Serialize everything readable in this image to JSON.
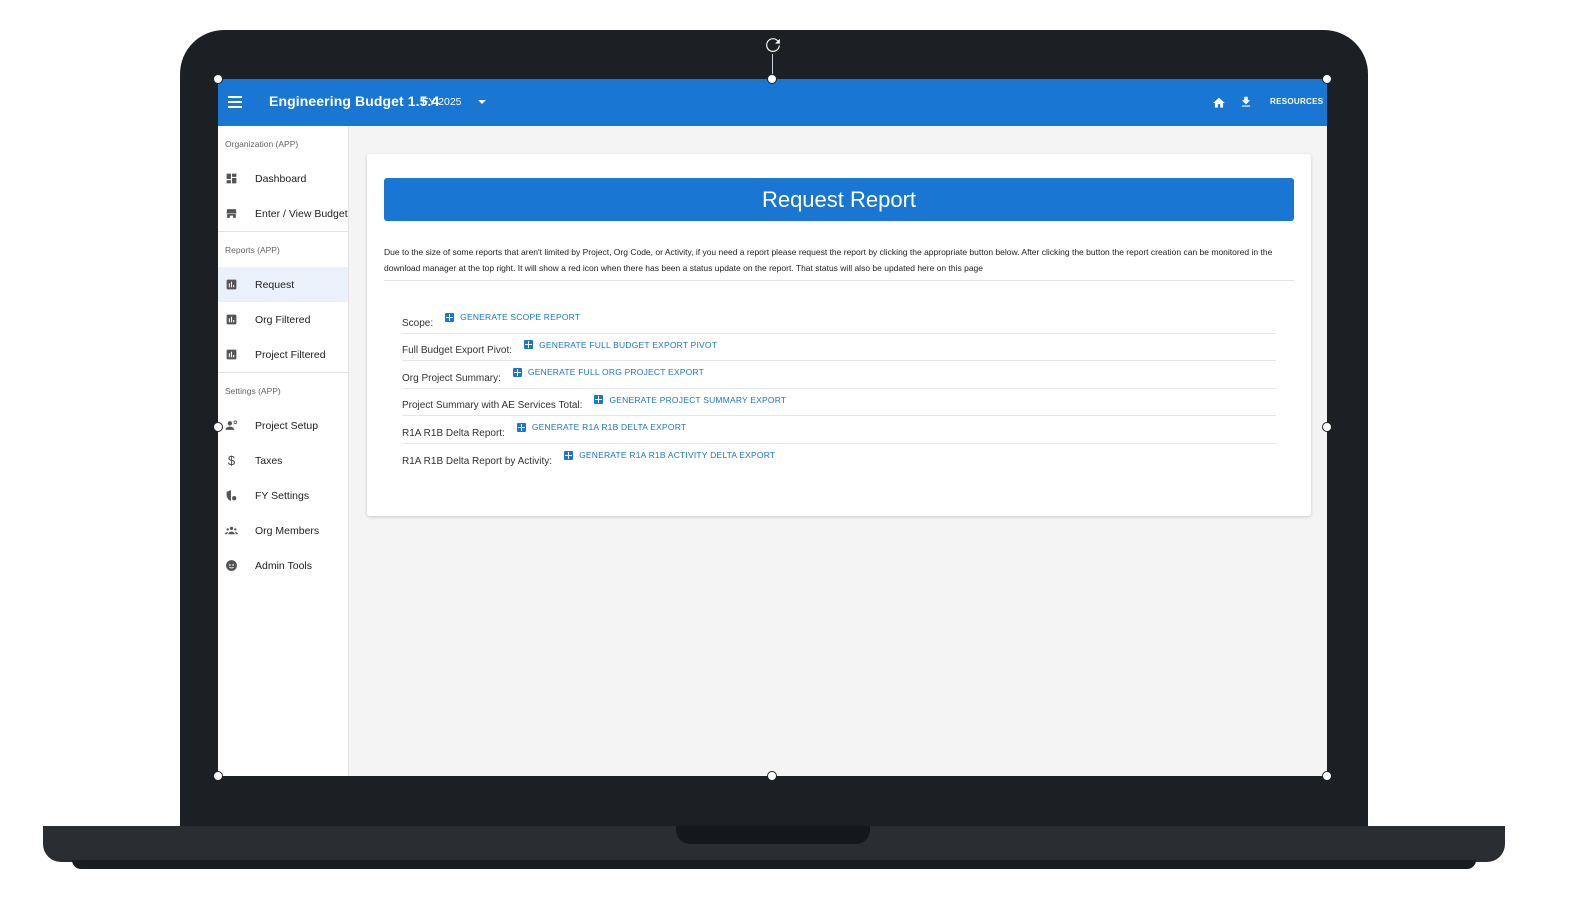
{
  "appbar": {
    "title": "Engineering Budget 1.5.4",
    "fiscal_year": "FY 2025",
    "resources_label": "RESOURCES"
  },
  "sidebar": {
    "sections": [
      {
        "label": "Organization (APP)",
        "items": [
          {
            "label": "Dashboard",
            "icon": "dashboard-icon"
          },
          {
            "label": "Enter / View Budget",
            "icon": "store-icon"
          }
        ]
      },
      {
        "label": "Reports (APP)",
        "items": [
          {
            "label": "Request",
            "icon": "bar-chart-icon",
            "active": true
          },
          {
            "label": "Org Filtered",
            "icon": "bar-chart-icon"
          },
          {
            "label": "Project Filtered",
            "icon": "bar-chart-icon"
          }
        ]
      },
      {
        "label": "Settings (APP)",
        "items": [
          {
            "label": "Project Setup",
            "icon": "person-settings-icon"
          },
          {
            "label": "Taxes",
            "icon": "dollar-icon"
          },
          {
            "label": "FY Settings",
            "icon": "shield-settings-icon"
          },
          {
            "label": "Org Members",
            "icon": "group-icon"
          },
          {
            "label": "Admin Tools",
            "icon": "admin-face-icon"
          }
        ]
      }
    ]
  },
  "main": {
    "title": "Request Report",
    "description": "Due to the size of some reports that aren't limited by Project, Org Code, or Activity, if you need a report please request the report by clicking the appropriate button below. After clicking the button the report creation can be monitored in the download manager at the top right. It will show a red icon when there has been a status update on the report. That status will also be updated here on this page",
    "reports": [
      {
        "label": "Scope:",
        "button": "GENERATE SCOPE REPORT"
      },
      {
        "label": "Full Budget Export Pivot:",
        "button": "GENERATE FULL BUDGET EXPORT PIVOT"
      },
      {
        "label": "Org Project Summary:",
        "button": "GENERATE FULL ORG PROJECT EXPORT"
      },
      {
        "label": "Project Summary with AE Services Total:",
        "button": "GENERATE PROJECT SUMMARY EXPORT"
      },
      {
        "label": "R1A R1B Delta Report:",
        "button": "GENERATE R1A R1B DELTA EXPORT"
      },
      {
        "label": "R1A R1B Delta Report by Activity:",
        "button": "GENERATE R1A R1B ACTIVITY DELTA EXPORT"
      }
    ]
  },
  "colors": {
    "primary": "#1976d2",
    "laptop_frame": "#1c2024",
    "page_bg": "#f4f4f4"
  }
}
